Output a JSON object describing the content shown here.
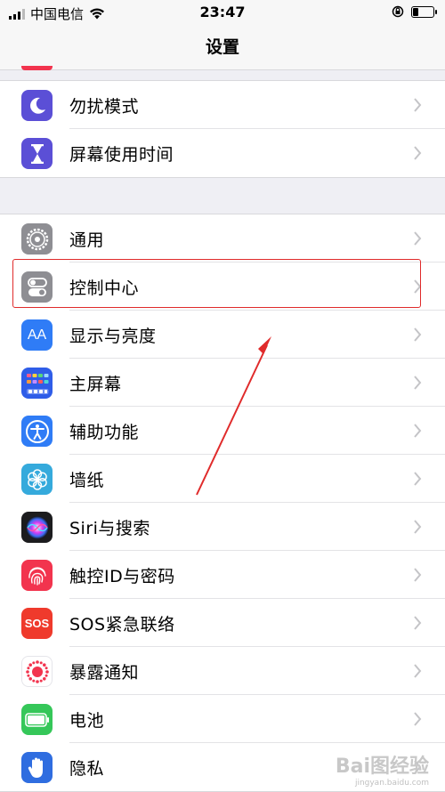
{
  "status_bar": {
    "carrier": "中国电信",
    "time": "23:47"
  },
  "nav": {
    "title": "设置"
  },
  "group1": [
    {
      "label": "勿扰模式",
      "icon": "moon-icon",
      "color": "#5b4fd6"
    },
    {
      "label": "屏幕使用时间",
      "icon": "hourglass-icon",
      "color": "#5b4fd6"
    }
  ],
  "group2": [
    {
      "label": "通用",
      "icon": "gear-icon",
      "color": "#8e8e93"
    },
    {
      "label": "控制中心",
      "icon": "toggle-icon",
      "color": "#8e8e93"
    },
    {
      "label": "显示与亮度",
      "icon": "aa-icon",
      "color": "#2f7cf6"
    },
    {
      "label": "主屏幕",
      "icon": "home-grid-icon",
      "color": "#2f5de8"
    },
    {
      "label": "辅助功能",
      "icon": "accessibility-icon",
      "color": "#2f7cf6"
    },
    {
      "label": "墙纸",
      "icon": "flower-icon",
      "color": "#35aadc"
    },
    {
      "label": "Siri与搜索",
      "icon": "siri-icon",
      "color": "#222222"
    },
    {
      "label": "触控ID与密码",
      "icon": "fingerprint-icon",
      "color": "#f2344e"
    },
    {
      "label": "SOS紧急联络",
      "icon": "sos-icon",
      "color": "#ef3a2c"
    },
    {
      "label": "暴露通知",
      "icon": "exposure-icon",
      "color": "#ffffff"
    },
    {
      "label": "电池",
      "icon": "battery-icon",
      "color": "#35c759"
    },
    {
      "label": "隐私",
      "icon": "hand-icon",
      "color": "#2f6de0"
    }
  ],
  "sos_text": "SOS",
  "aa_text": "AA",
  "watermark": {
    "main": "Bai图经验",
    "sub": "jingyan.baidu.com"
  },
  "accent": {
    "highlight": "#e02b2b"
  }
}
